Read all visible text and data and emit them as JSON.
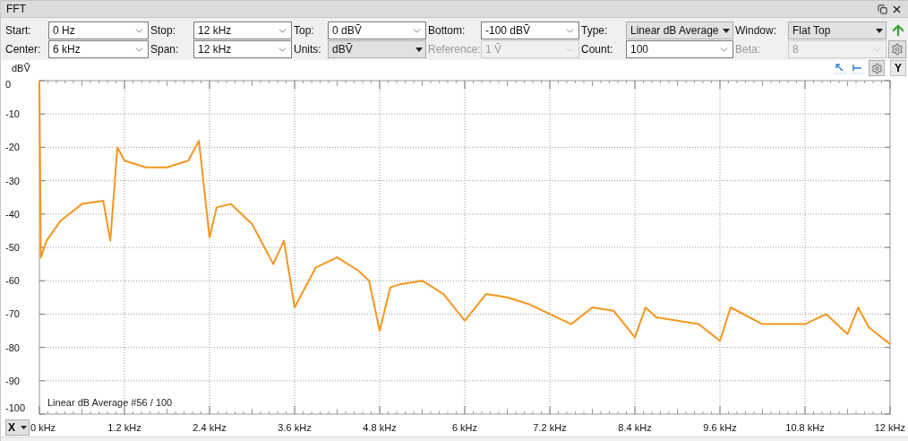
{
  "panel": {
    "title": "FFT"
  },
  "controls": [
    [
      {
        "label": "Start:",
        "value": "0 Hz",
        "kind": "combo",
        "disabled": false
      },
      {
        "label": "Stop:",
        "value": "12 kHz",
        "kind": "combo",
        "disabled": false
      },
      {
        "label": "Top:",
        "value": "0 dBṼ",
        "kind": "combo",
        "disabled": false
      },
      {
        "label": "Bottom:",
        "value": "-100 dBṼ",
        "kind": "combo",
        "disabled": false
      },
      {
        "label": "Type:",
        "value": "Linear dB Average",
        "kind": "dropdown",
        "disabled": false
      },
      {
        "label": "Window:",
        "value": "Flat Top",
        "kind": "dropdown",
        "disabled": false
      }
    ],
    [
      {
        "label": "Center:",
        "value": "6 kHz",
        "kind": "combo",
        "disabled": false
      },
      {
        "label": "Span:",
        "value": "12 kHz",
        "kind": "combo",
        "disabled": false
      },
      {
        "label": "Units:",
        "value": "dBṼ",
        "kind": "dropdown",
        "disabled": false
      },
      {
        "label": "Reference:",
        "value": "1 Ṽ",
        "kind": "combo",
        "disabled": true
      },
      {
        "label": "Count:",
        "value": "100",
        "kind": "combo",
        "disabled": false
      },
      {
        "label": "Beta:",
        "value": "8",
        "kind": "combo",
        "disabled": true
      }
    ]
  ],
  "y_unit": "dBṼ",
  "y_axis_button": "Y",
  "x_axis_button": "X",
  "chart": {
    "status_text": "Linear dB Average #56 / 100",
    "chart_data": {
      "type": "line",
      "grid": true,
      "xlim": [
        0,
        12
      ],
      "ylim": [
        -100,
        0
      ],
      "xticks": [
        {
          "value": 0,
          "label": "0 kHz"
        },
        {
          "value": 1.2,
          "label": "1.2 kHz"
        },
        {
          "value": 2.4,
          "label": "2.4 kHz"
        },
        {
          "value": 3.6,
          "label": "3.6 kHz"
        },
        {
          "value": 4.8,
          "label": "4.8 kHz"
        },
        {
          "value": 6,
          "label": "6 kHz"
        },
        {
          "value": 7.2,
          "label": "7.2 kHz"
        },
        {
          "value": 8.4,
          "label": "8.4 kHz"
        },
        {
          "value": 9.6,
          "label": "9.6 kHz"
        },
        {
          "value": 10.8,
          "label": "10.8 kHz"
        },
        {
          "value": 12,
          "label": "12 kHz"
        }
      ],
      "yticks": [
        {
          "value": 0,
          "label": "0"
        },
        {
          "value": -10,
          "label": "-10"
        },
        {
          "value": -20,
          "label": "-20"
        },
        {
          "value": -30,
          "label": "-30"
        },
        {
          "value": -40,
          "label": "-40"
        },
        {
          "value": -50,
          "label": "-50"
        },
        {
          "value": -60,
          "label": "-60"
        },
        {
          "value": -70,
          "label": "-70"
        },
        {
          "value": -80,
          "label": "-80"
        },
        {
          "value": -90,
          "label": "-90"
        },
        {
          "value": -100,
          "label": "-100"
        }
      ],
      "x": [
        0,
        0.02,
        0.1,
        0.3,
        0.6,
        0.9,
        1.0,
        1.1,
        1.2,
        1.5,
        1.8,
        2.1,
        2.25,
        2.4,
        2.5,
        2.7,
        3.0,
        3.3,
        3.45,
        3.6,
        3.9,
        4.2,
        4.5,
        4.65,
        4.8,
        4.95,
        5.1,
        5.4,
        5.7,
        6.0,
        6.3,
        6.6,
        6.9,
        7.2,
        7.5,
        7.8,
        8.1,
        8.4,
        8.55,
        8.7,
        9.0,
        9.3,
        9.6,
        9.75,
        10.2,
        10.5,
        10.8,
        11.1,
        11.4,
        11.55,
        11.7,
        12.0
      ],
      "series": [
        {
          "color": "#f5961e",
          "values": [
            0,
            -53,
            -48,
            -42,
            -37,
            -36,
            -48,
            -20,
            -24,
            -26,
            -26,
            -24,
            -18,
            -47,
            -38,
            -37,
            -43,
            -55,
            -48,
            -68,
            -56,
            -53,
            -57,
            -60,
            -75,
            -62,
            -61,
            -60,
            -64,
            -72,
            -64,
            -65,
            -67,
            -70,
            -73,
            -68,
            -69,
            -77,
            -68,
            -71,
            -72,
            -73,
            -78,
            -68,
            -73,
            -73,
            -73,
            -70,
            -76,
            -68,
            -74,
            -79
          ]
        }
      ]
    }
  }
}
